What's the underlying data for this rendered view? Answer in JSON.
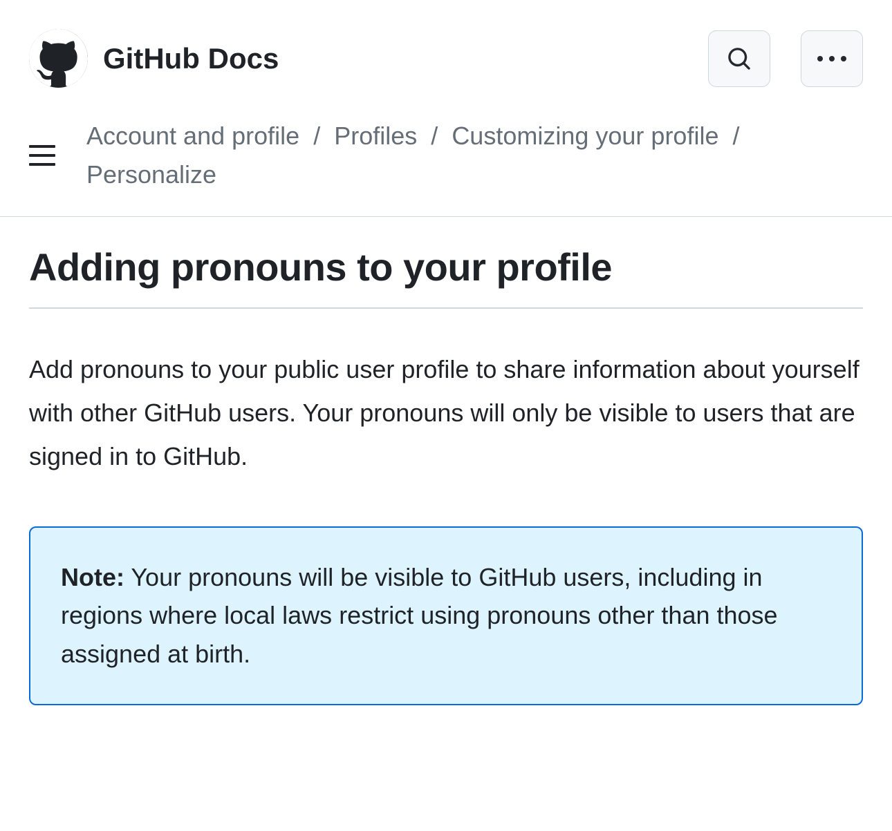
{
  "header": {
    "title": "GitHub Docs"
  },
  "breadcrumbs": {
    "items": [
      "Account and profile",
      "Profiles",
      "Customizing your profile",
      "Personalize"
    ]
  },
  "page": {
    "title": "Adding pronouns to your profile",
    "intro": "Add pronouns to your public user profile to share information about yourself with other GitHub users. Your pronouns will only be visible to users that are signed in to GitHub."
  },
  "note": {
    "label": "Note:",
    "text": " Your pronouns will be visible to GitHub users, including in regions where local laws restrict using pronouns other than those assigned at birth."
  }
}
